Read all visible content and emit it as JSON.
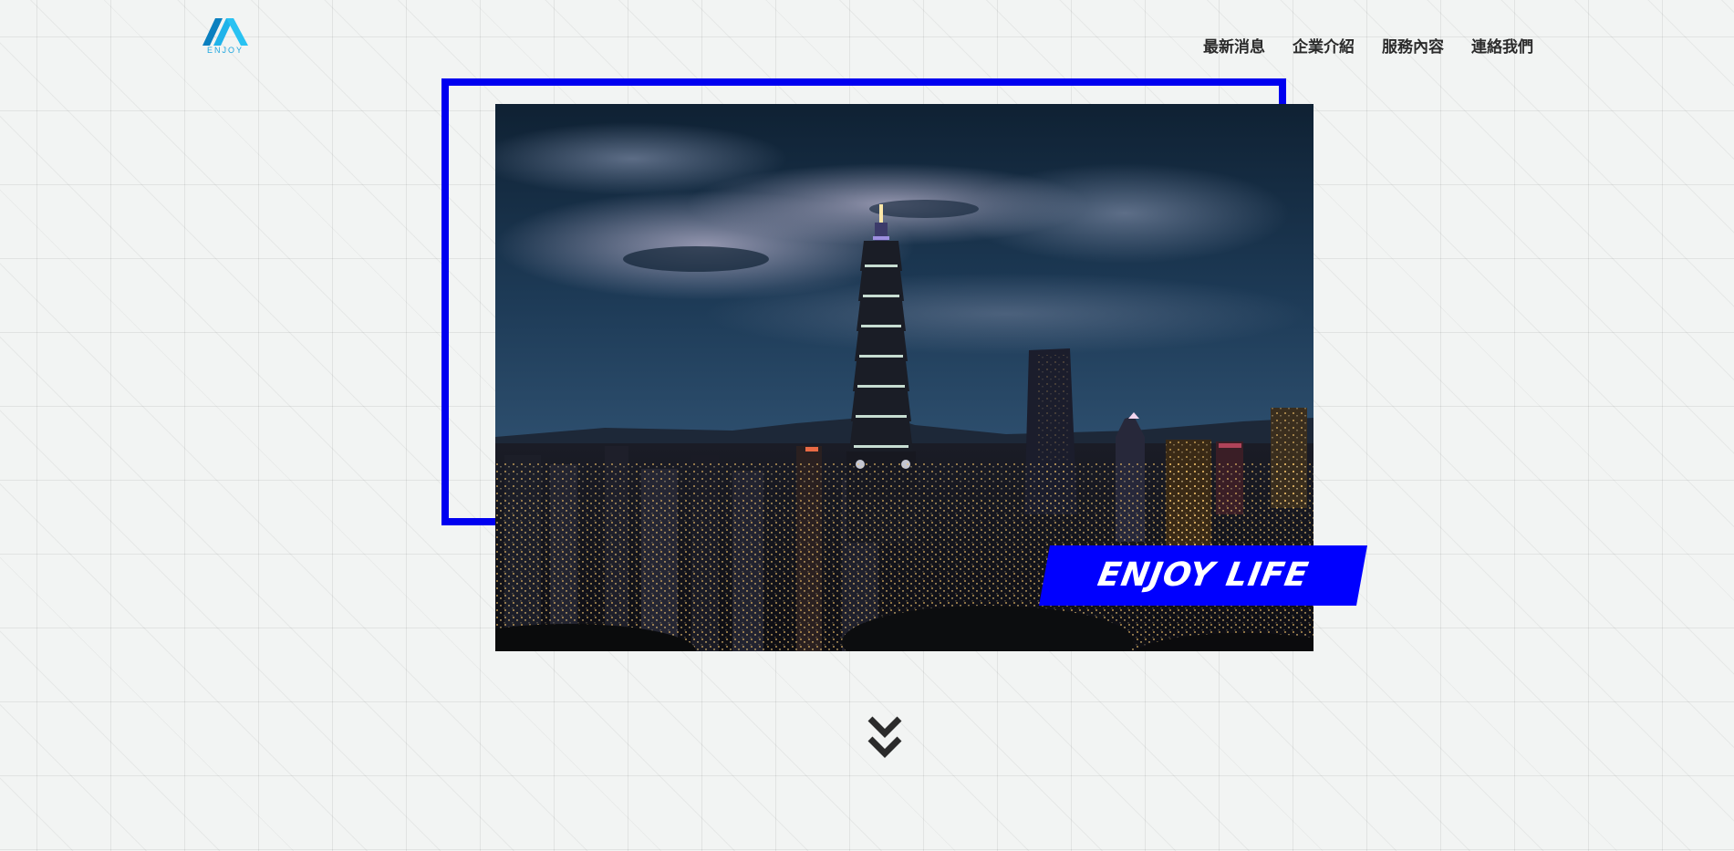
{
  "brand": {
    "logo_text": "ENJOY",
    "colors": {
      "logo_light": "#1fb3ea",
      "logo_dark": "#0a7fbf"
    }
  },
  "nav": {
    "items": [
      {
        "label": "最新消息"
      },
      {
        "label": "企業介紹"
      },
      {
        "label": "服務內容"
      },
      {
        "label": "連絡我們"
      }
    ]
  },
  "hero": {
    "image_icon": "taipei-night-skyline-photo",
    "badge_text": "ENJOY LIFE",
    "accent_color": "#0000ff"
  },
  "scroll": {
    "icon": "double-chevron-down-icon"
  }
}
